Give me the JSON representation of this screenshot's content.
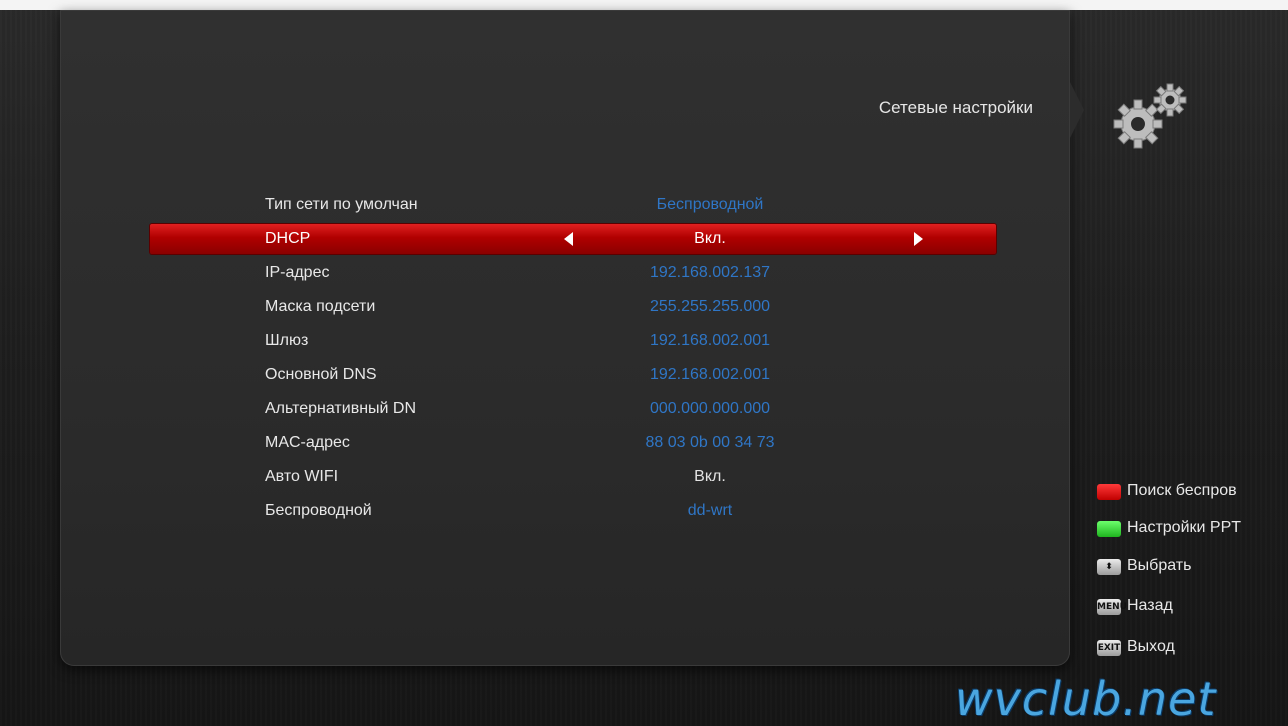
{
  "header": {
    "title": "Сетевые настройки"
  },
  "settings": [
    {
      "label": "Тип сети по умолчан",
      "value": "Беспроводной"
    },
    {
      "label": "DHCP",
      "value": "Вкл."
    },
    {
      "label": "IP-адрес",
      "value": "192.168.002.137"
    },
    {
      "label": "Маска подсети",
      "value": "255.255.255.000"
    },
    {
      "label": "Шлюз",
      "value": "192.168.002.001"
    },
    {
      "label": "Основной DNS",
      "value": "192.168.002.001"
    },
    {
      "label": "Альтернативный DN",
      "value": "000.000.000.000"
    },
    {
      "label": "MAC-адрес",
      "value": "88 03 0b 00 34 73"
    },
    {
      "label": "Авто WIFI",
      "value": "Вкл."
    },
    {
      "label": "Беспроводной",
      "value": "dd-wrt"
    }
  ],
  "selected_index": 1,
  "legend": [
    {
      "key": "red",
      "key_label": "",
      "text": "Поиск беспров"
    },
    {
      "key": "green",
      "key_label": "",
      "text": "Настройки PPT"
    },
    {
      "key": "updown",
      "key_label": "⬍",
      "text": "Выбрать"
    },
    {
      "key": "menu",
      "key_label": "MENU",
      "text": "Назад"
    },
    {
      "key": "exit",
      "key_label": "EXIT",
      "text": "Выход"
    }
  ],
  "watermark": "wvclub.net",
  "colors": {
    "accent_blue": "#2f76c6",
    "selected_red": "#c00000"
  }
}
